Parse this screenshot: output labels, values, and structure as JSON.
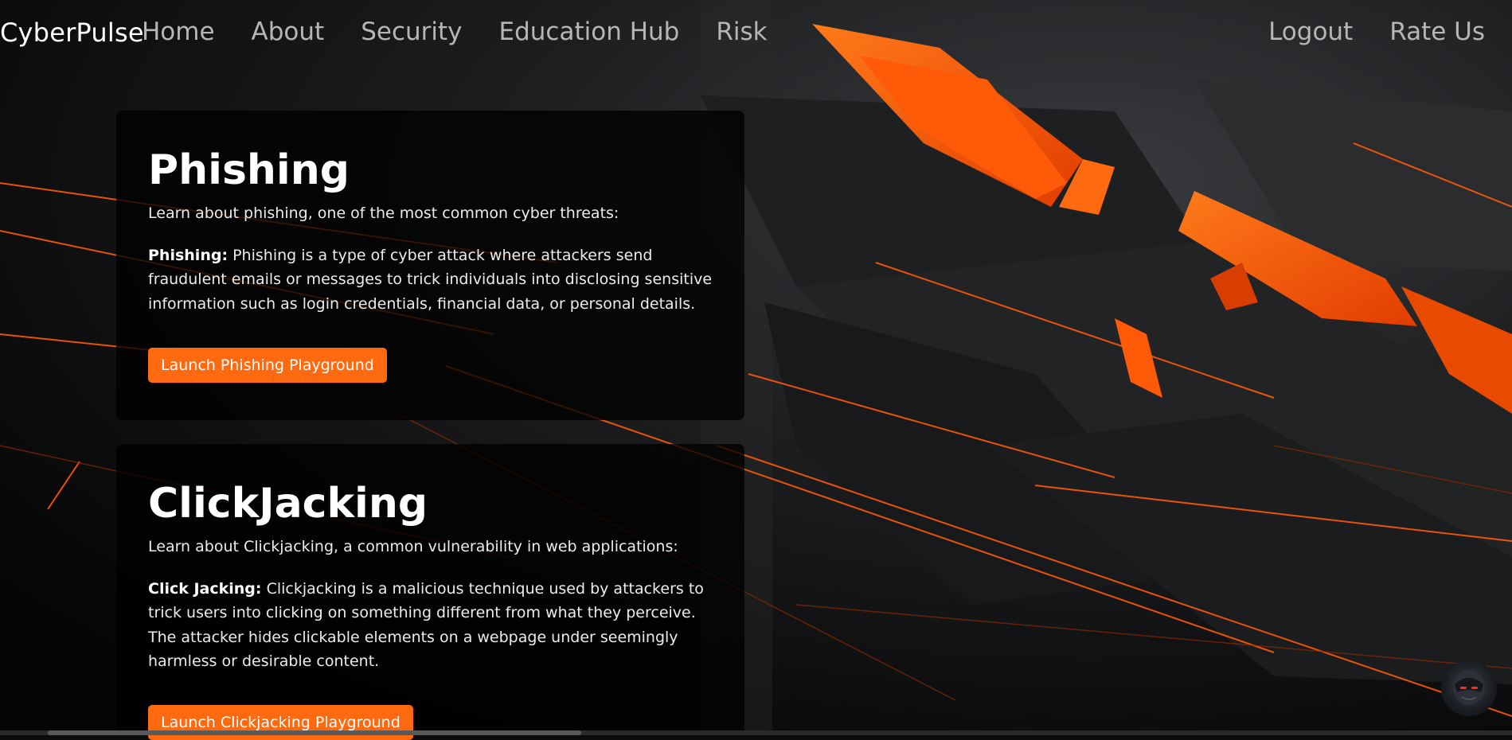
{
  "nav": {
    "brand": "CyberPulse",
    "left_links": [
      "Home",
      "About",
      "Security",
      "Education Hub",
      "Risk"
    ],
    "right_links": [
      "Logout",
      "Rate Us"
    ]
  },
  "sections": [
    {
      "title": "Phishing",
      "intro": "Learn about phishing, one of the most common cyber threats:",
      "term": "Phishing:",
      "description": "Phishing is a type of cyber attack where attackers send fraudulent emails or messages to trick individuals into disclosing sensitive information such as login credentials, financial data, or personal details.",
      "button": "Launch Phishing Playground"
    },
    {
      "title": "ClickJacking",
      "intro": "Learn about Clickjacking, a common vulnerability in web applications:",
      "term": "Click Jacking:",
      "description": "Clickjacking is a malicious technique used by attackers to trick users into clicking on something different from what they perceive. The attacker hides clickable elements on a webpage under seemingly harmless or desirable content.",
      "button": "Launch Clickjacking Playground"
    }
  ],
  "colors": {
    "accent": "#ff6a10",
    "background": "#0b0b0c",
    "nav_link": "#b6b6b6"
  },
  "icons": {
    "chat_avatar": "robot-avatar-icon"
  }
}
